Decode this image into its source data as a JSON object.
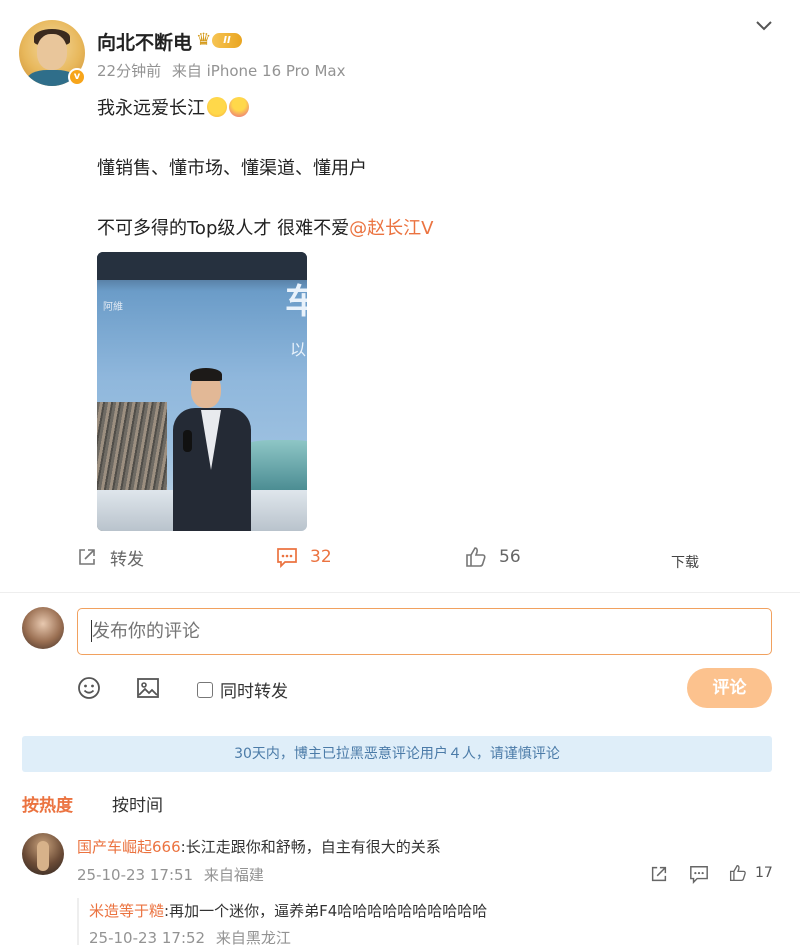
{
  "post": {
    "author": "向北不断电",
    "time": "22分钟前",
    "source": "来自 iPhone 16 Pro Max",
    "level_badge": "II",
    "line1": "我永远爱长江",
    "line2": "懂销售、懂市场、懂渠道、懂用户",
    "line3": "不可多得的Top级人才 很难不爱",
    "mention": "@赵长江",
    "mention_badge": "V",
    "photo_text_1": "车",
    "photo_text_2": "以",
    "photo_logo": "阿維"
  },
  "actions": {
    "repost_label": "转发",
    "comment_count": "32",
    "like_count": "56",
    "download_label": "下载"
  },
  "composer": {
    "placeholder": "发布你的评论",
    "same_repost_label": "同时转发",
    "submit_label": "评论"
  },
  "notice": "30天内，博主已拉黑恶意评论用户４人，请谨慎评论",
  "sort": {
    "hot": "按热度",
    "time": "按时间"
  },
  "comments": [
    {
      "user": "国产车崛起666",
      "text": ":长江走跟你和舒畅，自主有很大的关系",
      "time": "25-10-23 17:51",
      "location": "来自福建",
      "likes": "17",
      "reply": {
        "user": "米造等于糙",
        "text": ":再加一个迷你，逼养弟F4哈哈哈哈哈哈哈哈哈哈",
        "time": "25-10-23 17:52",
        "location": "来自黑龙江"
      }
    }
  ],
  "colors": {
    "accent": "#eb7340",
    "notice_bg": "#dfeef9",
    "notice_text": "#4b7ba8",
    "submit_bg": "#fcc28e"
  }
}
